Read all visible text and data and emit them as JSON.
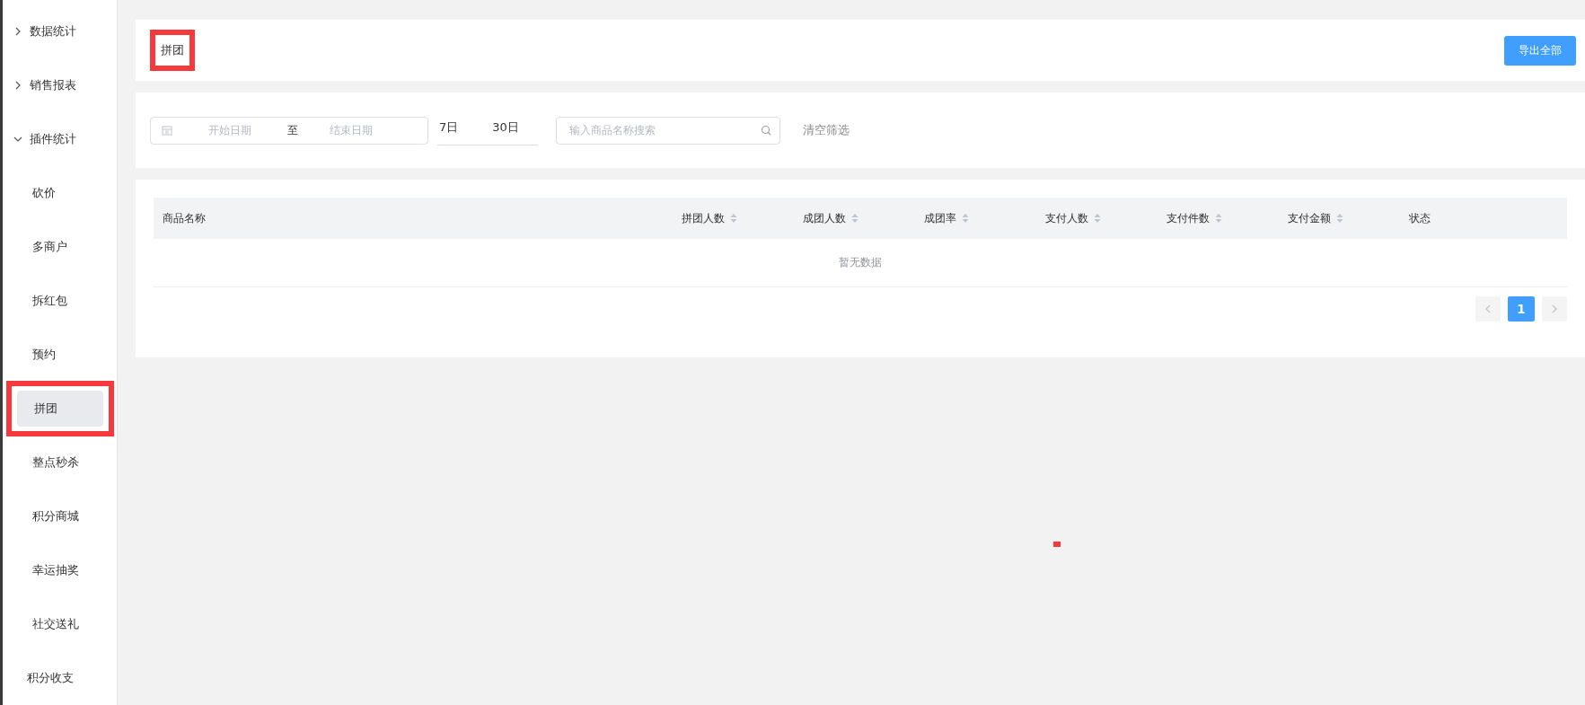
{
  "sidebar": {
    "groups": [
      {
        "label": "数据统计",
        "expanded": false
      },
      {
        "label": "销售报表",
        "expanded": false
      },
      {
        "label": "插件统计",
        "expanded": true,
        "children": [
          {
            "label": "砍价",
            "selected": false
          },
          {
            "label": "多商户",
            "selected": false
          },
          {
            "label": "拆红包",
            "selected": false
          },
          {
            "label": "预约",
            "selected": false
          },
          {
            "label": "拼团",
            "selected": true,
            "highlighted": true
          },
          {
            "label": "整点秒杀",
            "selected": false
          },
          {
            "label": "积分商城",
            "selected": false
          },
          {
            "label": "幸运抽奖",
            "selected": false
          },
          {
            "label": "社交送礼",
            "selected": false
          }
        ]
      }
    ],
    "footer_item": "积分收支"
  },
  "header": {
    "title": "拼团",
    "title_highlighted": true,
    "export_button": "导出全部"
  },
  "filters": {
    "start_placeholder": "开始日期",
    "separator": "至",
    "end_placeholder": "结束日期",
    "quick_ranges": [
      "7日",
      "30日"
    ],
    "search_placeholder": "输入商品名称搜索",
    "clear": "清空筛选"
  },
  "table": {
    "columns": [
      {
        "label": "商品名称",
        "sortable": false
      },
      {
        "label": "拼团人数",
        "sortable": true
      },
      {
        "label": "成团人数",
        "sortable": true
      },
      {
        "label": "成团率",
        "sortable": true
      },
      {
        "label": "支付人数",
        "sortable": true
      },
      {
        "label": "支付件数",
        "sortable": true
      },
      {
        "label": "支付金额",
        "sortable": true
      },
      {
        "label": "状态",
        "sortable": false
      }
    ],
    "empty_text": "暂无数据"
  },
  "pagination": {
    "pages": [
      {
        "label": "1",
        "selected": true
      }
    ]
  }
}
